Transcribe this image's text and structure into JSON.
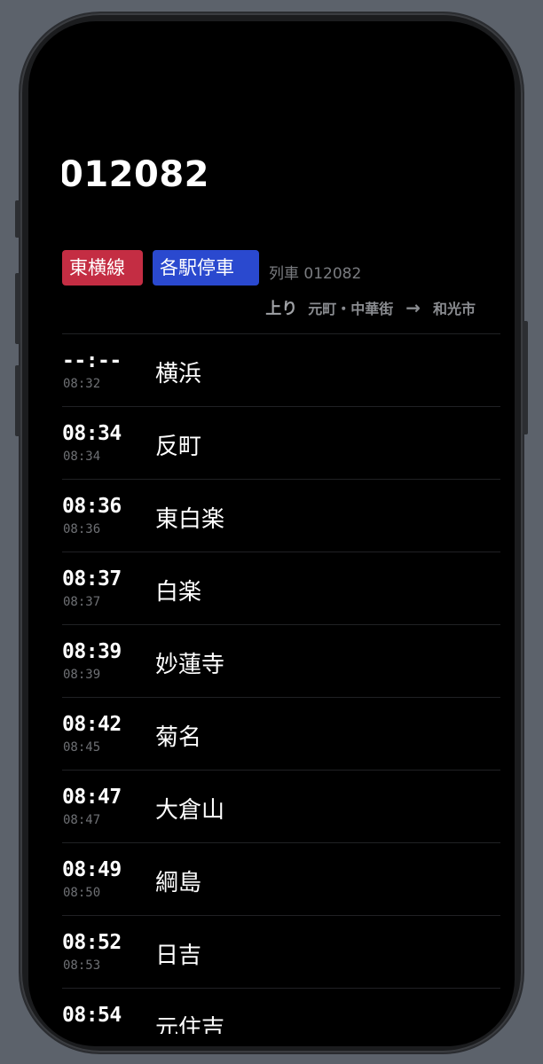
{
  "train": {
    "number": "012082",
    "line": "東横線",
    "type": "各駅停車",
    "train_label": "列車 012082",
    "direction": "上り",
    "origin": "元町・中華街",
    "arrow": "→",
    "destination": "和光市"
  },
  "colors": {
    "line_badge": "#c42d43",
    "type_badge": "#2a49cf",
    "background": "#000000"
  },
  "stops": [
    {
      "time": "--:--",
      "scheduled": "08:32",
      "station": "横浜"
    },
    {
      "time": "08:34",
      "scheduled": "08:34",
      "station": "反町"
    },
    {
      "time": "08:36",
      "scheduled": "08:36",
      "station": "東白楽"
    },
    {
      "time": "08:37",
      "scheduled": "08:37",
      "station": "白楽"
    },
    {
      "time": "08:39",
      "scheduled": "08:39",
      "station": "妙蓮寺"
    },
    {
      "time": "08:42",
      "scheduled": "08:45",
      "station": "菊名"
    },
    {
      "time": "08:47",
      "scheduled": "08:47",
      "station": "大倉山"
    },
    {
      "time": "08:49",
      "scheduled": "08:50",
      "station": "綱島"
    },
    {
      "time": "08:52",
      "scheduled": "08:53",
      "station": "日吉"
    },
    {
      "time": "08:54",
      "scheduled": "",
      "station": "元住吉"
    }
  ]
}
